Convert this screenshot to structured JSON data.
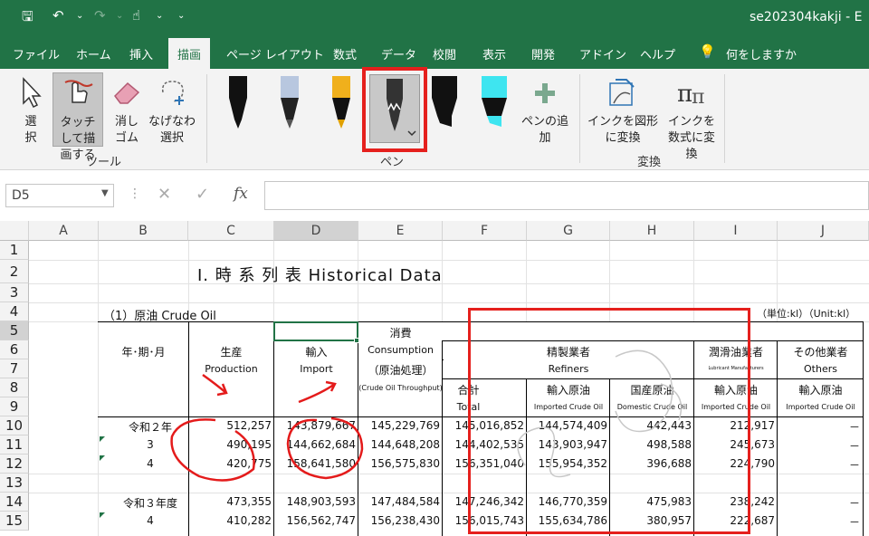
{
  "titlebar": {
    "doc_title": "se202304kakji - E"
  },
  "menu": {
    "tabs": [
      "ファイル",
      "ホーム",
      "挿入",
      "描画",
      "ページ レイアウト",
      "数式",
      "データ",
      "校閲",
      "表示",
      "開発",
      "アドイン",
      "ヘルプ"
    ],
    "search": "何をしますか"
  },
  "ribbon": {
    "select_label": "選択",
    "touch_draw_label": "タッチして描画する",
    "eraser_label": "消しゴム",
    "lasso_label": "なげなわ選択",
    "tools_group": "ツール",
    "add_pen_label": "ペンの追加",
    "pens_group": "ペン",
    "ink_to_shape_label": "インクを図形に変換",
    "ink_to_math_label": "インクを数式に変換",
    "convert_group": "変換"
  },
  "formula": {
    "namebox": "D5"
  },
  "columns": [
    "A",
    "B",
    "C",
    "D",
    "E",
    "F",
    "G",
    "H",
    "I",
    "J"
  ],
  "rows": [
    "1",
    "2",
    "3",
    "4",
    "5",
    "6",
    "7",
    "8",
    "9",
    "10",
    "11",
    "12",
    "13",
    "14",
    "15"
  ],
  "sheet": {
    "title": "I. 時 系 列 表 Historical Data",
    "section": "（1）原油 Crude Oil",
    "unit": "（単位:kl）（Unit:kl）",
    "consumption": "消費",
    "h_year": "年･期･月",
    "h_production_jp": "生産",
    "h_production_en": "Production",
    "h_import_jp": "輸入",
    "h_import_en": "Import",
    "h_consumption_en": "Consumption",
    "h_consumption_jp": "（原油処理）",
    "h_throughput": "(Crude Oil Throughput)",
    "h_refiners_jp": "精製業者",
    "h_refiners_en": "Refiners",
    "h_lubricant_jp": "潤滑油業者",
    "h_lubricant_en": "Lubricant Manufacturers",
    "h_others_jp": "その他業者",
    "h_others_en": "Others",
    "h_total_jp": "合計",
    "h_total_en": "Total",
    "h_imported_jp": "輸入原油",
    "h_imported_en": "Imported Crude Oil",
    "h_domestic_jp": "国産原油",
    "h_domestic_en": "Domestic Crude Oil",
    "h_imported2_jp": "輸入原油",
    "h_imported2_en": "Imported Crude Oil",
    "h_imported3_jp": "輸入原油",
    "h_imported3_en": "Imported Crude Oil",
    "data_rows": [
      {
        "label": "令和２年",
        "prod": "512,257",
        "imp": "143,879,667",
        "cons": "145,229,769",
        "total": "145,016,852",
        "imported": "144,574,409",
        "domestic": "442,443",
        "lub": "212,917",
        "oth": "－"
      },
      {
        "label": "3",
        "prod": "490,195",
        "imp": "144,662,684",
        "cons": "144,648,208",
        "total": "144,402,535",
        "imported": "143,903,947",
        "domestic": "498,588",
        "lub": "245,673",
        "oth": "－"
      },
      {
        "label": "4",
        "prod": "420,775",
        "imp": "158,641,580",
        "cons": "156,575,830",
        "total": "156,351,040",
        "imported": "155,954,352",
        "domestic": "396,688",
        "lub": "224,790",
        "oth": "－"
      },
      {
        "label": "令和３年度",
        "prod": "473,355",
        "imp": "148,903,593",
        "cons": "147,484,584",
        "total": "147,246,342",
        "imported": "146,770,359",
        "domestic": "475,983",
        "lub": "238,242",
        "oth": "－"
      },
      {
        "label": "4",
        "prod": "410,282",
        "imp": "156,562,747",
        "cons": "156,238,430",
        "total": "156,015,743",
        "imported": "155,634,786",
        "domestic": "380,957",
        "lub": "222,687",
        "oth": "－"
      }
    ]
  }
}
